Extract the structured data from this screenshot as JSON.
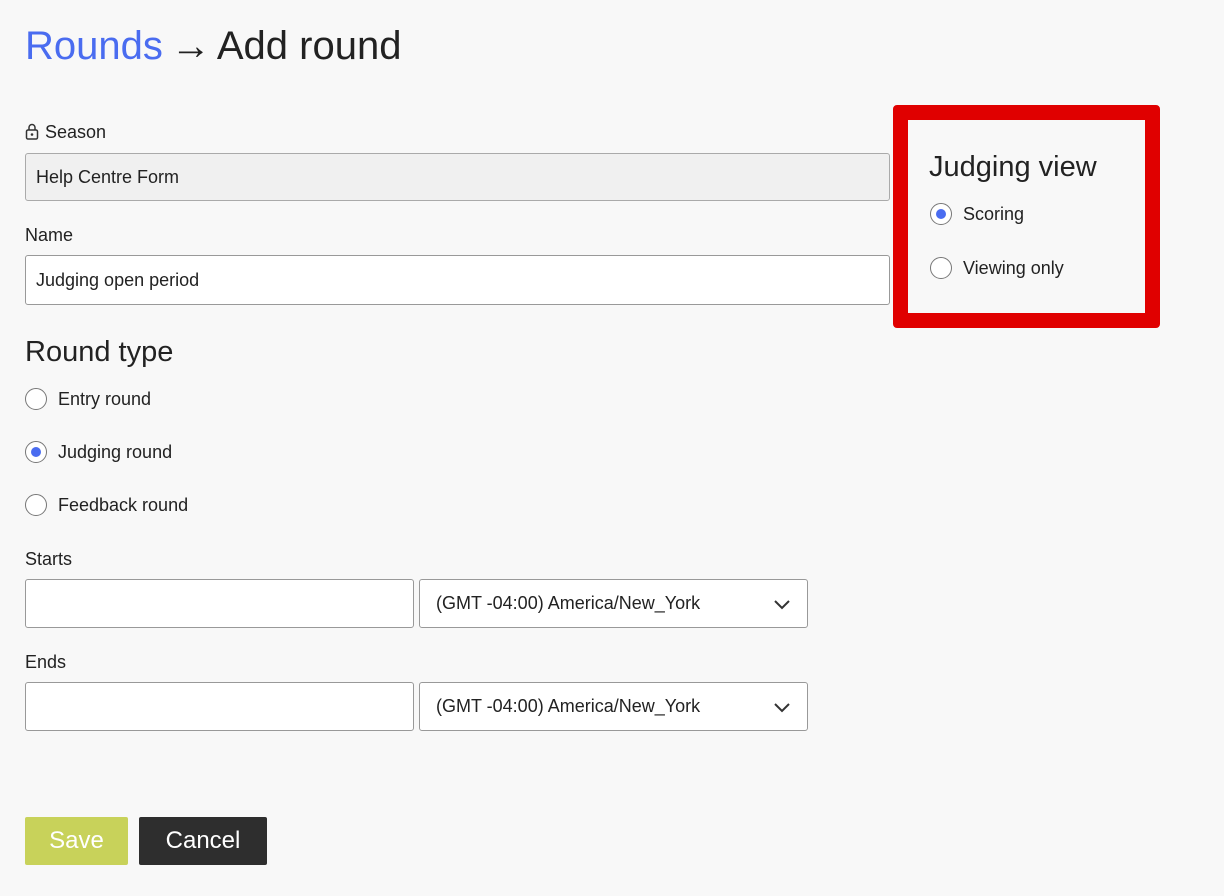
{
  "breadcrumb": {
    "parent": "Rounds",
    "arrow": "→",
    "current": "Add round"
  },
  "season": {
    "label": "Season",
    "value": "Help Centre Form",
    "icon": "lock-icon"
  },
  "name": {
    "label": "Name",
    "value": "Judging open period"
  },
  "round_type": {
    "title": "Round type",
    "options": [
      {
        "label": "Entry round",
        "checked": false
      },
      {
        "label": "Judging round",
        "checked": true
      },
      {
        "label": "Feedback round",
        "checked": false
      }
    ]
  },
  "starts": {
    "label": "Starts",
    "date_value": "",
    "timezone": "(GMT -04:00) America/New_York"
  },
  "ends": {
    "label": "Ends",
    "date_value": "",
    "timezone": "(GMT -04:00) America/New_York"
  },
  "judging_view": {
    "title": "Judging view",
    "options": [
      {
        "label": "Scoring",
        "checked": true
      },
      {
        "label": "Viewing only",
        "checked": false
      }
    ]
  },
  "actions": {
    "save_label": "Save",
    "cancel_label": "Cancel"
  },
  "colors": {
    "link": "#4a6cf0",
    "highlight": "#e00000",
    "save": "#c8d25a",
    "cancel": "#2e2e2e"
  }
}
